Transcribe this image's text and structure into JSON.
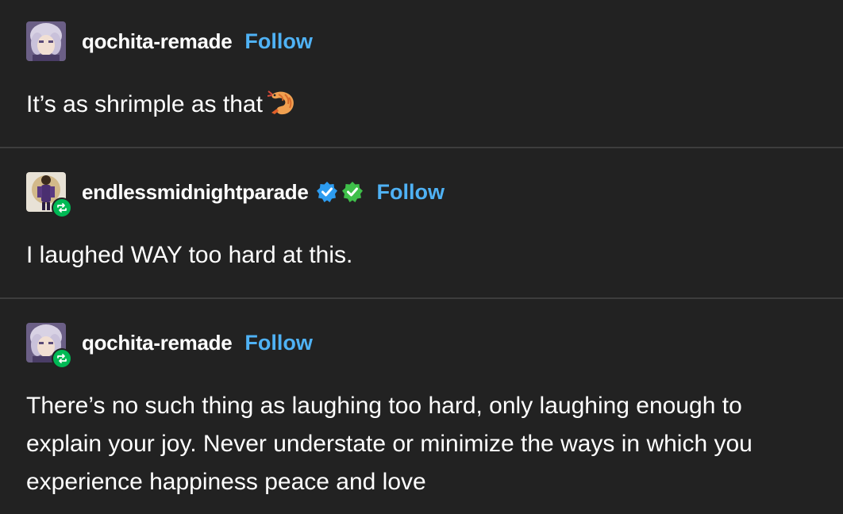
{
  "posts": [
    {
      "username": "qochita-remade",
      "follow_label": "Follow",
      "avatar": "anime-avatar-purple",
      "reblog": false,
      "verified_badges": [],
      "text": "It’s as shrimple as that",
      "emoji": "shrimp-icon"
    },
    {
      "username": "endlessmidnightparade",
      "follow_label": "Follow",
      "avatar": "figure-avatar",
      "reblog": true,
      "verified_badges": [
        "blue-checkmark-icon",
        "green-checkmark-icon"
      ],
      "text": "I laughed WAY too hard at this."
    },
    {
      "username": "qochita-remade",
      "follow_label": "Follow",
      "avatar": "anime-avatar-purple",
      "reblog": true,
      "verified_badges": [],
      "text": "There’s no such thing as laughing too hard, only laughing enough to explain your joy. Never understate or minimize the ways in which you experience happiness peace and love"
    }
  ],
  "colors": {
    "background": "#222222",
    "text": "#ffffff",
    "follow": "#4fb2f5",
    "divider": "#3d3d3d",
    "reblog_badge": "#00b955",
    "verified_blue": "#2d9cf0",
    "verified_green": "#3fbf4a"
  }
}
